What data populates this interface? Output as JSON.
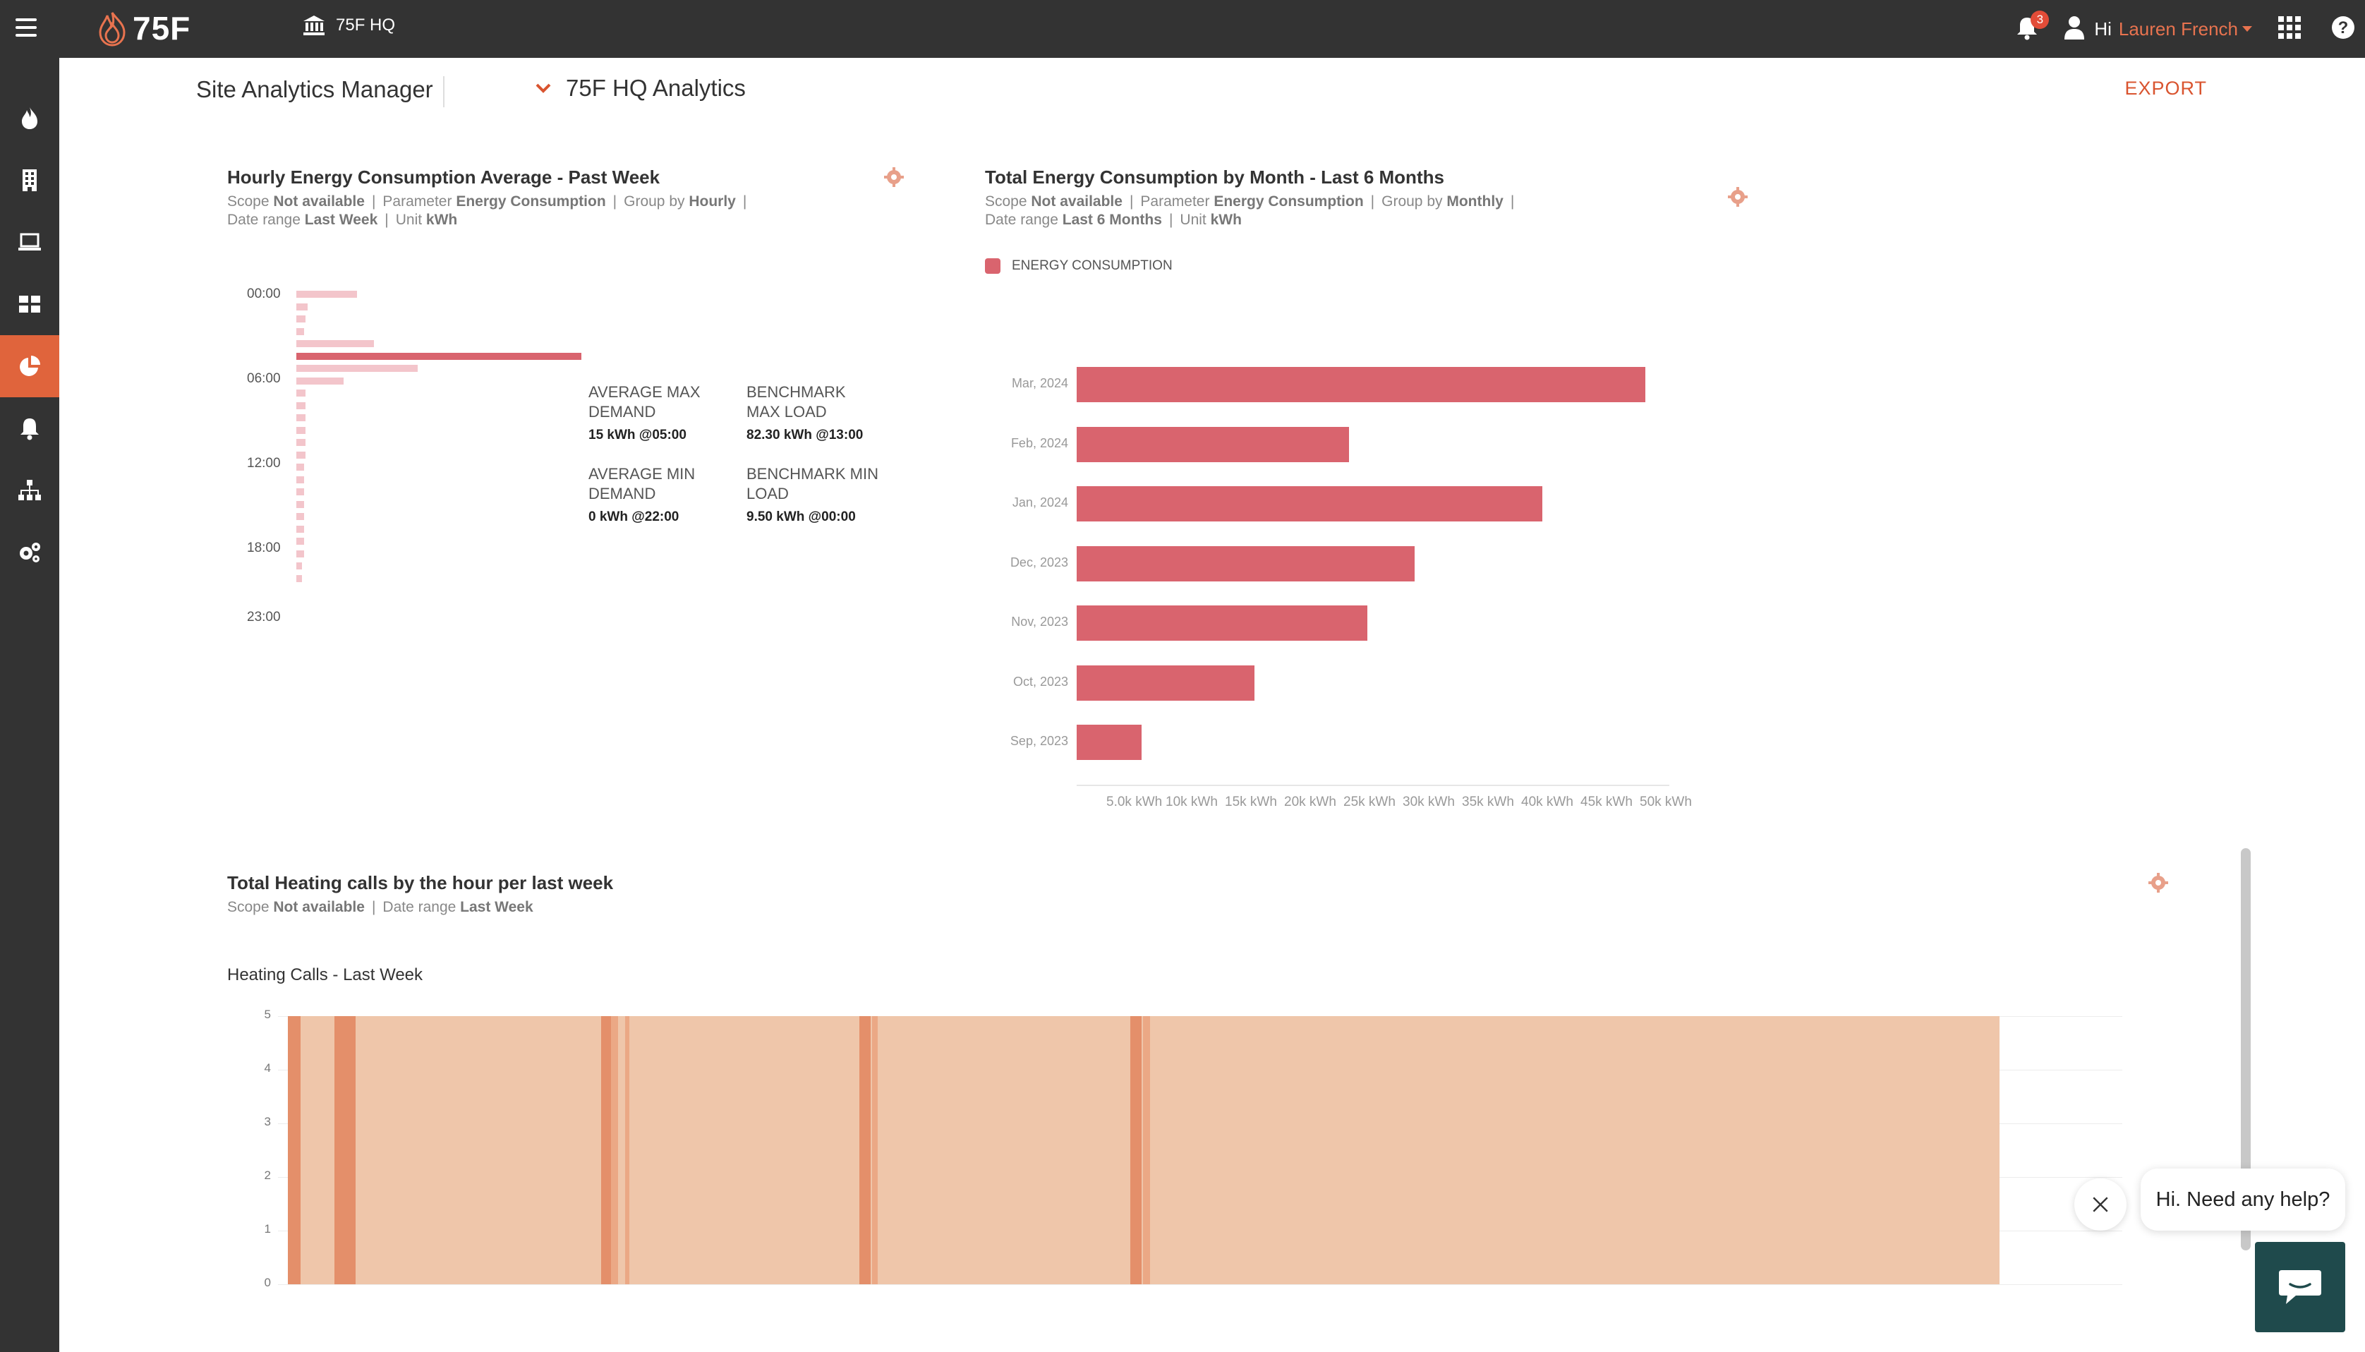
{
  "topbar": {
    "logo_text": "75F",
    "site_name": "75F HQ",
    "notification_count": "3",
    "greeting": "Hi",
    "user_name": "Lauren French"
  },
  "header": {
    "title": "Site Analytics Manager",
    "analytics_name": "75F HQ Analytics",
    "export_label": "EXPORT"
  },
  "widget_hourly": {
    "title": "Hourly Energy Consumption Average - Past Week",
    "scope_label": "Scope",
    "scope_value": "Not available",
    "parameter_label": "Parameter",
    "parameter_value": "Energy Consumption",
    "group_label": "Group by",
    "group_value": "Hourly",
    "date_label": "Date range",
    "date_value": "Last Week",
    "unit_label": "Unit",
    "unit_value": "kWh",
    "hour_labels": [
      "00:00",
      "06:00",
      "12:00",
      "18:00",
      "23:00"
    ],
    "stats": {
      "avg_max_label_1": "AVERAGE MAX",
      "avg_max_label_2": "DEMAND",
      "avg_max_value": "15 kWh @05:00",
      "bench_max_label_1": "BENCHMARK",
      "bench_max_label_2": "MAX LOAD",
      "bench_max_value": "82.30 kWh @13:00",
      "avg_min_label_1": "AVERAGE MIN",
      "avg_min_label_2": "DEMAND",
      "avg_min_value": "0 kWh @22:00",
      "bench_min_label_1": "BENCHMARK MIN",
      "bench_min_label_2": "LOAD",
      "bench_min_value": "9.50 kWh @00:00"
    },
    "hourly_values": [
      3.2,
      0.6,
      0.5,
      0.4,
      4.1,
      15,
      6.4,
      2.5,
      0.5,
      0.5,
      0.5,
      0.5,
      0.5,
      0.5,
      0.4,
      0.4,
      0.4,
      0.4,
      0.4,
      0.4,
      0.4,
      0.4,
      0.3,
      0.3
    ],
    "max_color": "#d9646e",
    "bar_color": "#f3c5cb"
  },
  "widget_monthly": {
    "title": "Total Energy Consumption by Month - Last 6 Months",
    "scope_label": "Scope",
    "scope_value": "Not available",
    "parameter_label": "Parameter",
    "parameter_value": "Energy Consumption",
    "group_label": "Group by",
    "group_value": "Monthly",
    "date_label": "Date range",
    "date_value": "Last 6 Months",
    "unit_label": "Unit",
    "unit_value": "kWh",
    "legend": "ENERGY CONSUMPTION",
    "bar_color": "#d9646e"
  },
  "widget_heating": {
    "title": "Total Heating calls by the hour per last week",
    "scope_label": "Scope",
    "scope_value": "Not available",
    "date_label": "Date range",
    "date_value": "Last Week",
    "subtitle": "Heating Calls - Last Week",
    "y_ticks": [
      "5",
      "4",
      "3",
      "2",
      "1",
      "0"
    ],
    "fill_color": "#efc6aa",
    "spike_color": "#e48f6a"
  },
  "chart_data": [
    {
      "type": "bar",
      "orientation": "horizontal",
      "categories": [
        "Mar, 2024",
        "Feb, 2024",
        "Jan, 2024",
        "Dec, 2023",
        "Nov, 2023",
        "Oct, 2023",
        "Sep, 2023"
      ],
      "series": [
        {
          "name": "ENERGY CONSUMPTION",
          "values": [
            48000,
            23000,
            39300,
            28500,
            24500,
            15000,
            5500
          ]
        }
      ],
      "x_ticks": [
        "5.0k kWh",
        "10k kWh",
        "15k kWh",
        "20k kWh",
        "25k kWh",
        "30k kWh",
        "35k kWh",
        "40k kWh",
        "45k kWh",
        "50k kWh"
      ],
      "xlim": [
        0,
        50000
      ],
      "title": "Total Energy Consumption by Month - Last 6 Months"
    },
    {
      "type": "area",
      "title": "Heating Calls - Last Week",
      "ylim": [
        0,
        5
      ],
      "y_ticks": [
        0,
        1,
        2,
        3,
        4,
        5
      ],
      "note_values": "Series holds at 5 across most of the week, ending around 95% of the time range"
    }
  ],
  "chat": {
    "message": "Hi. Need any help?"
  }
}
